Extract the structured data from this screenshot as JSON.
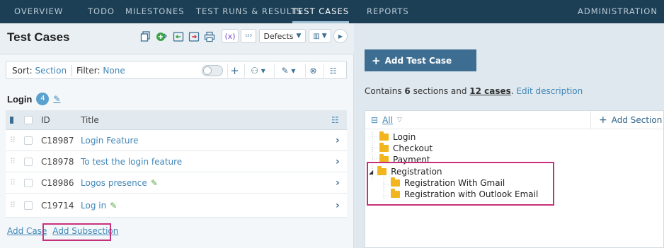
{
  "nav": {
    "items": [
      "OVERVIEW",
      "TODO",
      "MILESTONES",
      "TEST RUNS & RESULTS",
      "TEST CASES",
      "REPORTS"
    ],
    "admin": "ADMINISTRATION"
  },
  "left": {
    "title": "Test Cases",
    "toolbar": {
      "defects_label": "Defects"
    },
    "sort": {
      "sort_label": "Sort:",
      "sort_value": "Section",
      "filter_label": "Filter:",
      "filter_value": "None"
    },
    "section": {
      "name": "Login",
      "count": "4"
    },
    "table": {
      "col_id": "ID",
      "col_title": "Title",
      "rows": [
        {
          "id": "C18987",
          "title": "Login Feature",
          "edit_icon": false
        },
        {
          "id": "C18978",
          "title": "To test the login feature",
          "edit_icon": false
        },
        {
          "id": "C18986",
          "title": "Logos presence",
          "edit_icon": true
        },
        {
          "id": "C19714",
          "title": "Log in",
          "edit_icon": true
        }
      ]
    },
    "footer": {
      "add_case": "Add Case",
      "add_subsection": "Add Subsection"
    }
  },
  "right": {
    "add_case_button": "Add Test Case",
    "contains": {
      "prefix": "Contains",
      "sections": "6",
      "mid": "sections and",
      "cases": "12 cases",
      "suffix": ".",
      "edit": "Edit description"
    },
    "tree": {
      "all_label": "All",
      "add_section": "Add Section",
      "nodes": [
        "Login",
        "Checkout",
        "Payment",
        "Registration",
        "Registration With Gmail",
        "Registration with Outlook Email"
      ]
    }
  },
  "colors": {
    "nav_bg": "#1d3f55",
    "link": "#3f86b8",
    "highlight": "#c7317c",
    "folder": "#f2b51d",
    "primary_button": "#3d6d90"
  }
}
